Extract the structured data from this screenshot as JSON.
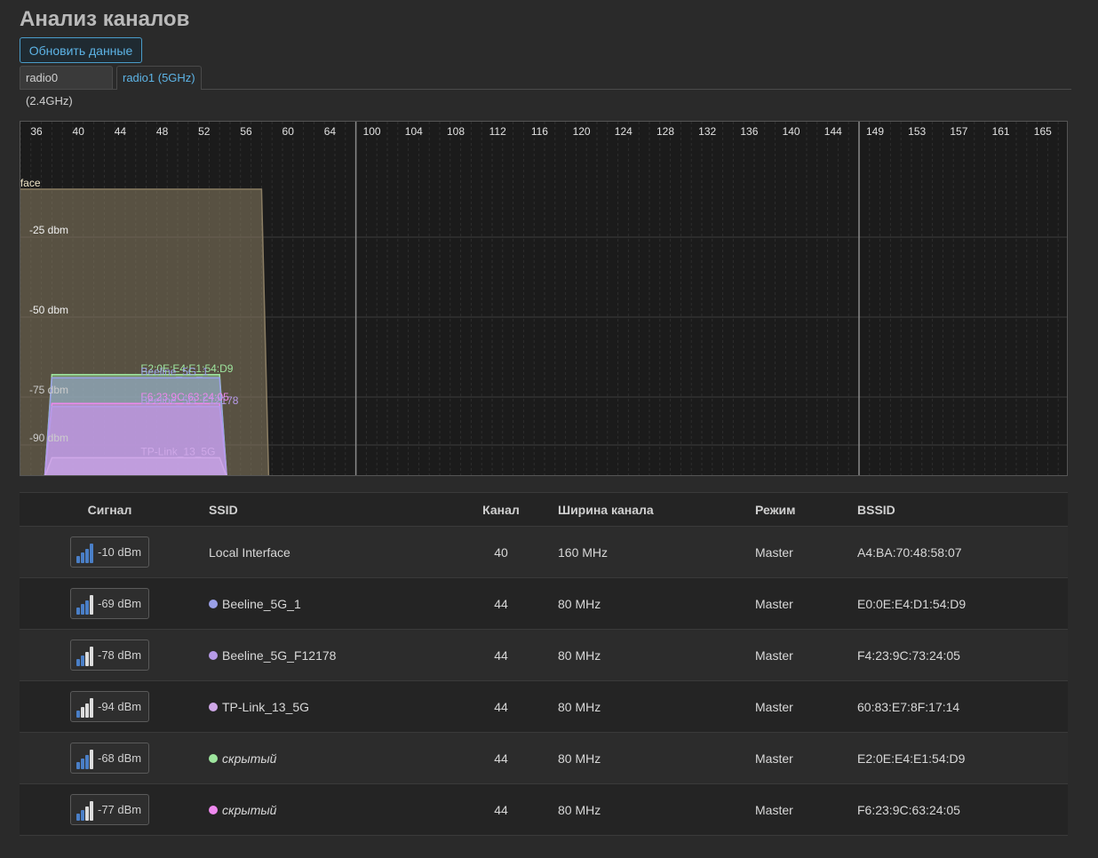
{
  "page": {
    "title": "Анализ каналов",
    "refresh_label": "Обновить данные",
    "tabs": [
      {
        "label": "radio0 (2.4GHz)",
        "active": false
      },
      {
        "label": "radio1 (5GHz)",
        "active": true
      }
    ]
  },
  "chart_data": {
    "type": "area",
    "channels": [
      "36",
      "40",
      "44",
      "48",
      "52",
      "56",
      "60",
      "64",
      "100",
      "104",
      "108",
      "112",
      "116",
      "120",
      "124",
      "128",
      "132",
      "136",
      "140",
      "144",
      "149",
      "153",
      "157",
      "161",
      "165"
    ],
    "band_separators_after": [
      "64",
      "144"
    ],
    "y_ticks": [
      "-25 dbm",
      "-50 dbm",
      "-75 dbm",
      "-90 dbm"
    ],
    "y_tick_values": [
      -25,
      -50,
      -75,
      -90
    ],
    "series": [
      {
        "name": "Local Interface",
        "center_channel": 40,
        "width_mhz": 160,
        "signal_dbm": -10,
        "color": "#8a7d63"
      },
      {
        "name": "E2:0E:E4:E1:54:D9",
        "center_channel": 44,
        "width_mhz": 80,
        "signal_dbm": -68,
        "color": "#9ee59e"
      },
      {
        "name": "Beeline_5G_1",
        "center_channel": 44,
        "width_mhz": 80,
        "signal_dbm": -69,
        "color": "#9aa0e8"
      },
      {
        "name": "F6:23:9C:63:24:05",
        "center_channel": 44,
        "width_mhz": 80,
        "signal_dbm": -77,
        "color": "#ee88ee"
      },
      {
        "name": "Beeline_5G_F12178",
        "center_channel": 44,
        "width_mhz": 80,
        "signal_dbm": -78,
        "color": "#b69ae8"
      },
      {
        "name": "TP-Link_13_5G",
        "center_channel": 44,
        "width_mhz": 80,
        "signal_dbm": -94,
        "color": "#cfa8e8"
      }
    ]
  },
  "table": {
    "headers": {
      "signal": "Сигнал",
      "ssid": "SSID",
      "channel": "Канал",
      "width": "Ширина канала",
      "mode": "Режим",
      "bssid": "BSSID"
    },
    "rows": [
      {
        "signal": "-10 dBm",
        "bars": 4,
        "ssid": "Local Interface",
        "dot": "",
        "hidden": false,
        "channel": "40",
        "width": "160 MHz",
        "mode": "Master",
        "bssid": "A4:BA:70:48:58:07"
      },
      {
        "signal": "-69 dBm",
        "bars": 3,
        "ssid": "Beeline_5G_1",
        "dot": "#9aa0e8",
        "hidden": false,
        "channel": "44",
        "width": "80 MHz",
        "mode": "Master",
        "bssid": "E0:0E:E4:D1:54:D9"
      },
      {
        "signal": "-78 dBm",
        "bars": 2,
        "ssid": "Beeline_5G_F12178",
        "dot": "#b69ae8",
        "hidden": false,
        "channel": "44",
        "width": "80 MHz",
        "mode": "Master",
        "bssid": "F4:23:9C:73:24:05"
      },
      {
        "signal": "-94 dBm",
        "bars": 1,
        "ssid": "TP-Link_13_5G",
        "dot": "#cfa8e8",
        "hidden": false,
        "channel": "44",
        "width": "80 MHz",
        "mode": "Master",
        "bssid": "60:83:E7:8F:17:14"
      },
      {
        "signal": "-68 dBm",
        "bars": 3,
        "ssid": "скрытый",
        "dot": "#9ee59e",
        "hidden": true,
        "channel": "44",
        "width": "80 MHz",
        "mode": "Master",
        "bssid": "E2:0E:E4:E1:54:D9"
      },
      {
        "signal": "-77 dBm",
        "bars": 2,
        "ssid": "скрытый",
        "dot": "#ee88ee",
        "hidden": true,
        "channel": "44",
        "width": "80 MHz",
        "mode": "Master",
        "bssid": "F6:23:9C:63:24:05"
      }
    ]
  }
}
